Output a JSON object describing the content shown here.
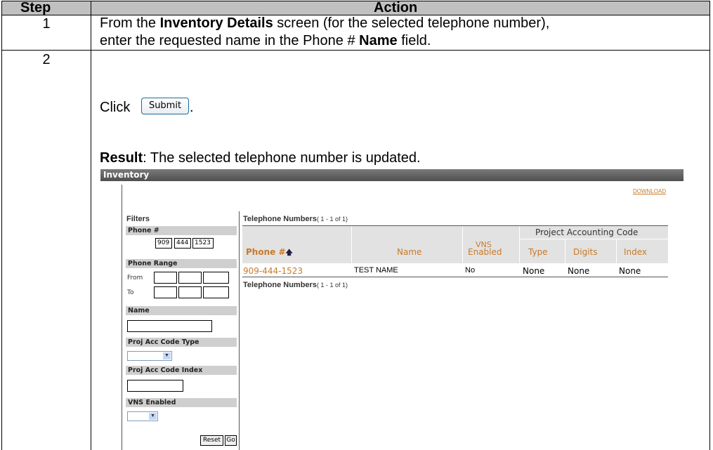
{
  "table": {
    "header_step": "Step",
    "header_action": "Action",
    "steps": [
      {
        "number": "1"
      },
      {
        "number": "2"
      }
    ],
    "step1": {
      "part1": "From the ",
      "bold1": "Inventory Details",
      "part2": " screen (for the selected telephone number),",
      "part3": "enter the requested name in the Phone # ",
      "bold2": "Name",
      "part4": " field."
    },
    "step2": {
      "click": "Click",
      "button_label": "Submit",
      "period": ".",
      "result_label": "Result",
      "result_text": ":  The selected telephone number is updated."
    }
  },
  "inventory": {
    "title": "Inventory",
    "download": "DOWNLOAD",
    "filters": {
      "title": "Filters",
      "phone_label": "Phone #",
      "phone_values": [
        "909",
        "444",
        "1523"
      ],
      "range_label": "Phone Range",
      "from_label": "From",
      "to_label": "To",
      "name_label": "Name",
      "pac_type_label": "Proj Acc Code Type",
      "pac_index_label": "Proj Acc Code Index",
      "vns_label": "VNS Enabled",
      "reset_label": "Reset",
      "go_label": "Go"
    },
    "numbers": {
      "title": "Telephone Numbers",
      "count": "( 1 - 1 of 1)",
      "group_header": "Project Accounting Code",
      "columns": {
        "phone": "Phone #",
        "name": "Name",
        "vns1": "VNS",
        "vns2": "Enabled",
        "type": "Type",
        "digits": "Digits",
        "index": "Index"
      },
      "rows": [
        {
          "phone": "909-444-1523",
          "name": "TEST NAME",
          "vns": "No",
          "type": "None",
          "digits": "None",
          "index": "None"
        }
      ]
    },
    "colors": {
      "link": "#c87a2a",
      "header_bg": "#e2e2e2",
      "bar": "#5a5a5a"
    },
    "icons": {
      "sort": "sort-ascending-arrow-icon",
      "dropdown": "chevron-down-icon"
    }
  }
}
